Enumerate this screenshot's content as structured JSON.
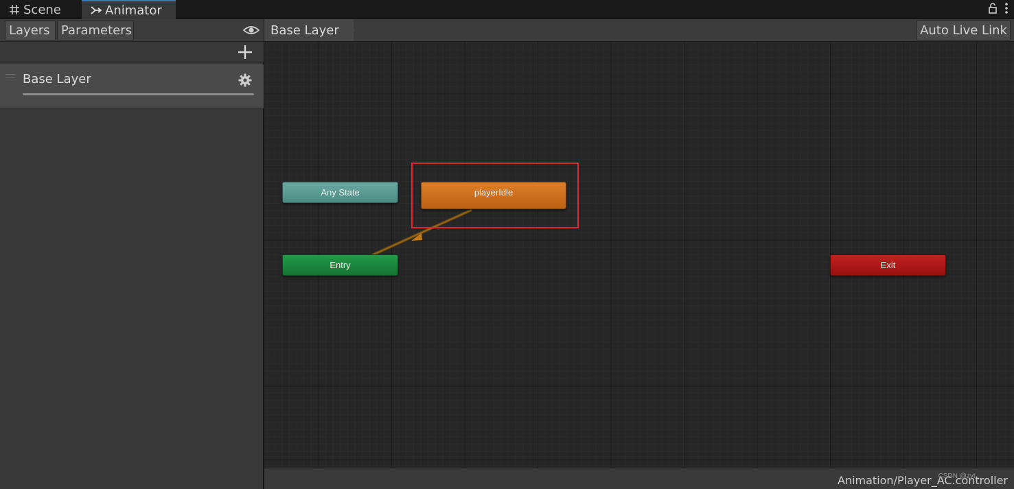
{
  "window_tabs": [
    {
      "label": "Scene",
      "icon": "grid-hash-icon"
    },
    {
      "label": "Animator",
      "icon": "animator-icon",
      "active": true
    }
  ],
  "left_panel": {
    "tabs": [
      {
        "label": "Layers",
        "active": true
      },
      {
        "label": "Parameters"
      }
    ],
    "layers": [
      {
        "name": "Base Layer",
        "weight": 1.0
      }
    ]
  },
  "graph_toolbar": {
    "breadcrumb": "Base Layer",
    "auto_live_link": "Auto Live Link"
  },
  "graph": {
    "states": [
      {
        "name": "Any State",
        "kind": "any",
        "color": "#5c9a93"
      },
      {
        "name": "playerIdle",
        "kind": "default",
        "color": "#cf7020"
      },
      {
        "name": "Entry",
        "kind": "entry",
        "color": "#1b8a3e"
      },
      {
        "name": "Exit",
        "kind": "exit",
        "color": "#ad1818"
      }
    ],
    "transitions": [
      {
        "from": "Entry",
        "to": "playerIdle",
        "color": "#c47a16"
      }
    ],
    "highlight_color": "#e02631"
  },
  "status": {
    "asset_path": "Animation/Player_AC.controller",
    "watermark": "CSDN @zyt..."
  }
}
